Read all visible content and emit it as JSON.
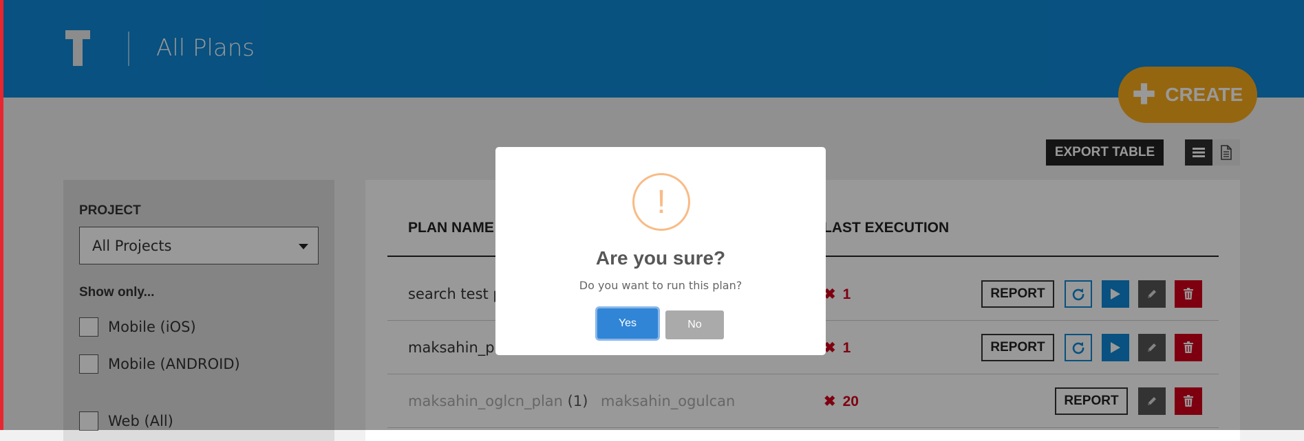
{
  "header": {
    "logo_letter": "T",
    "title": "All Plans",
    "create_label": "CREATE"
  },
  "toolbar": {
    "export_label": "EXPORT TABLE",
    "view_list_icon": "list-icon",
    "view_doc_icon": "document-icon"
  },
  "sidebar": {
    "project_label": "PROJECT",
    "project_value": "All Projects",
    "show_only_label": "Show only...",
    "filters": [
      {
        "label": "Mobile (iOS)",
        "checked": false
      },
      {
        "label": "Mobile (ANDROID)",
        "checked": false
      },
      {
        "label": "Web (All)",
        "checked": false
      }
    ]
  },
  "table": {
    "headers": {
      "plan_name": "PLAN NAME",
      "last_execution": "LAST EXECUTION"
    },
    "rows": [
      {
        "plan_name": "search test p",
        "project": "",
        "last_execution": "1",
        "report_label": "REPORT",
        "dimmed": false
      },
      {
        "plan_name": "maksahin_pla",
        "project": "",
        "last_execution": "1",
        "report_label": "REPORT",
        "dimmed": false
      },
      {
        "plan_name": "maksahin_oglcn_plan",
        "plan_count": "(1)",
        "project": "maksahin_ogulcan",
        "last_execution": "20",
        "report_label": "REPORT",
        "dimmed": true
      }
    ]
  },
  "modal": {
    "icon": "warning-icon",
    "icon_glyph": "!",
    "title": "Are you sure?",
    "text": "Do you want to run this plan?",
    "confirm_label": "Yes",
    "cancel_label": "No"
  },
  "colors": {
    "header_bg": "#0e88d5",
    "create_bg": "#f8aa1c",
    "run_blue": "#0e88d5",
    "delete_red": "#d2001b",
    "confirm_blue": "#3085d6",
    "warning": "#f8bb86"
  }
}
